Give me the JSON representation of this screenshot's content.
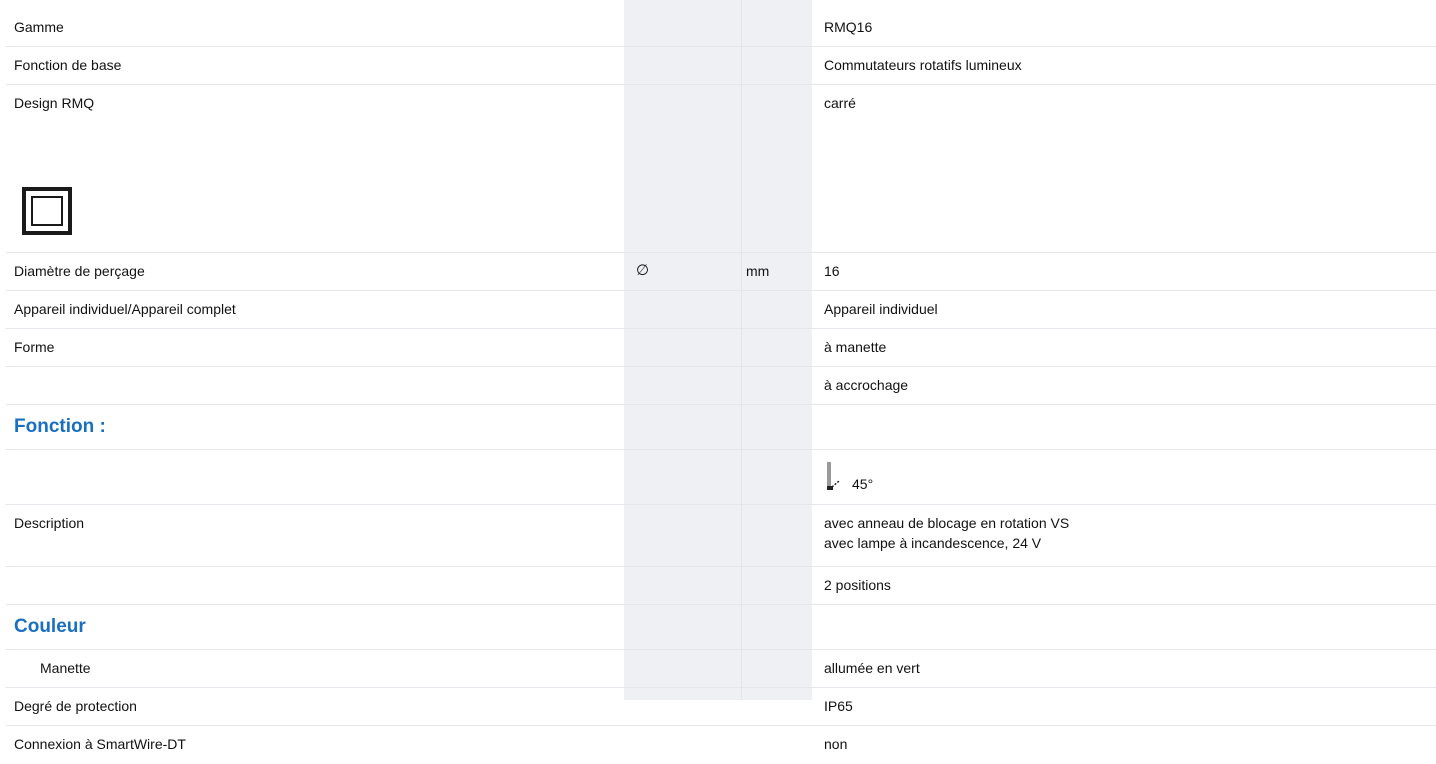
{
  "rows": {
    "gamme": {
      "label": "Gamme",
      "value": "RMQ16"
    },
    "fonction_base": {
      "label": "Fonction de base",
      "value": "Commutateurs rotatifs lumineux"
    },
    "design": {
      "label": "Design RMQ",
      "value": "carré",
      "icon": "square-design-icon"
    },
    "diametre": {
      "label": "Diamètre de perçage",
      "symbol": "∅",
      "unit": "mm",
      "value": "16"
    },
    "appareil": {
      "label": "Appareil individuel/Appareil complet",
      "value": "Appareil individuel"
    },
    "forme": {
      "label": "Forme",
      "value": "à manette"
    },
    "forme2": {
      "value": "à accrochage"
    },
    "fonction_header": {
      "label": "Fonction :"
    },
    "fonction_icon": {
      "icon": "rotary-lever-icon",
      "angle": "45°"
    },
    "description": {
      "label": "Description",
      "line1": "avec anneau de blocage en rotation VS",
      "line2": "avec lampe à incandescence, 24 V"
    },
    "positions": {
      "value": "2 positions"
    },
    "couleur_header": {
      "label": "Couleur"
    },
    "manette": {
      "label": "Manette",
      "value": "allumée en vert"
    },
    "protection": {
      "label": "Degré de protection",
      "value": "IP65"
    },
    "smartwire": {
      "label": "Connexion à SmartWire-DT",
      "value": "non"
    }
  },
  "colors": {
    "section_heading": "#1a6fbf",
    "shaded_column": "#eef0f4",
    "row_divider": "#e3e6ea"
  }
}
